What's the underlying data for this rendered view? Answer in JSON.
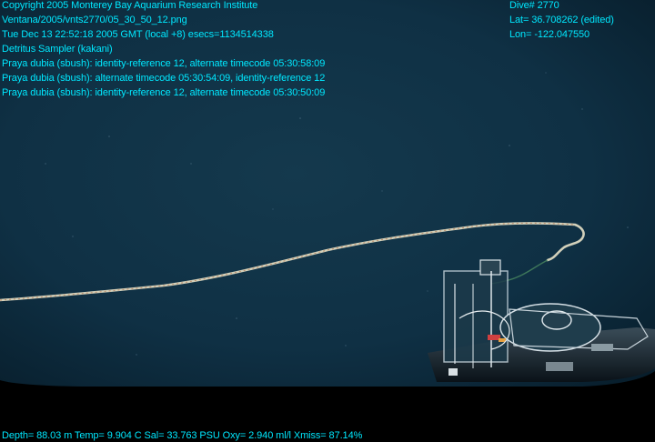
{
  "overlay": {
    "copyright": "Copyright 2005 Monterey Bay Aquarium Research Institute",
    "file_path": "Ventana/2005/vnts2770/05_30_50_12.png",
    "timestamp": "Tue Dec 13 22:52:18 2005 GMT (local +8)  esecs=1134514338",
    "sampler": "Detritus Sampler (kakani)",
    "annotations": [
      "Praya dubia (sbush): identity-reference 12, alternate timecode 05:30:58:09",
      "Praya dubia (sbush): alternate timecode 05:30:54:09, identity-reference 12",
      "Praya dubia (sbush): identity-reference 12, alternate timecode 05:30:50:09"
    ],
    "dive": "Dive# 2770",
    "latitude": "Lat= 36.708262 (edited)",
    "longitude": "Lon= -122.047550",
    "sensors": "Depth= 88.03 m  Temp= 9.904 C  Sal= 33.763 PSU  Oxy= 2.940 ml/l  Xmiss= 87.14%"
  },
  "colors": {
    "text_cyan": "#00e8ff",
    "water_dark": "#0b2a3c",
    "water_mid": "#103548",
    "frame_black": "#000000"
  }
}
